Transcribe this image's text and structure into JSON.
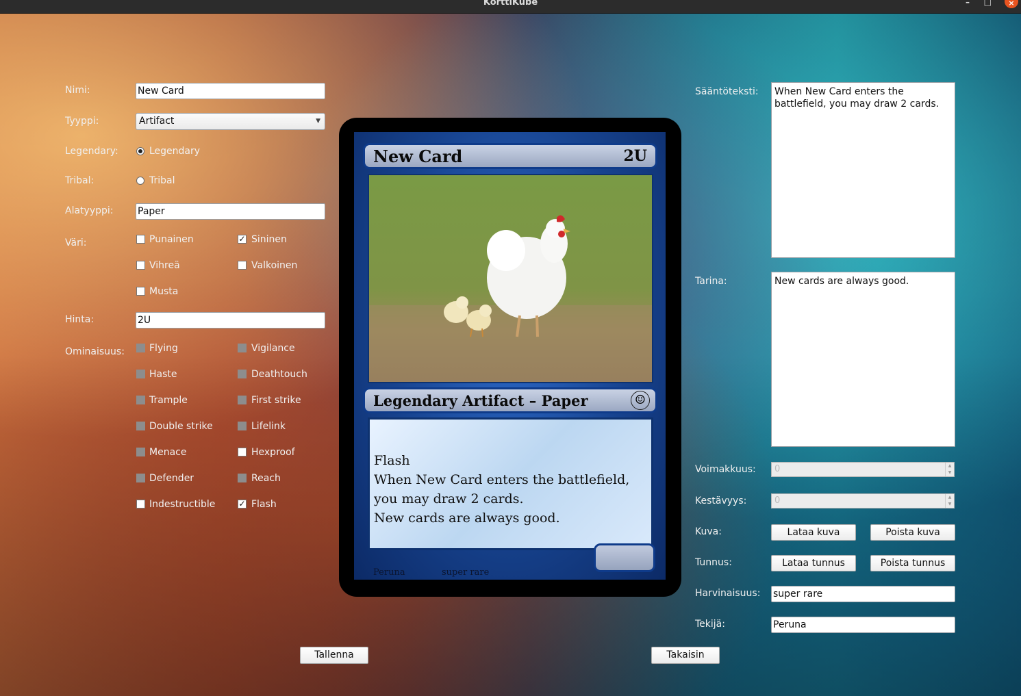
{
  "window": {
    "title": "KorttiKube"
  },
  "form_left": {
    "name_label": "Nimi:",
    "name_value": "New Card",
    "type_label": "Tyyppi:",
    "type_value": "Artifact",
    "legendary_label": "Legendary:",
    "legendary_option": "Legendary",
    "tribal_label": "Tribal:",
    "tribal_option": "Tribal",
    "subtype_label": "Alatyyppi:",
    "subtype_value": "Paper",
    "color_label": "Väri:",
    "colors": [
      {
        "label": "Punainen",
        "checked": false
      },
      {
        "label": "Sininen",
        "checked": true
      },
      {
        "label": "Vihreä",
        "checked": false
      },
      {
        "label": "Valkoinen",
        "checked": false
      },
      {
        "label": "Musta",
        "checked": false
      }
    ],
    "cost_label": "Hinta:",
    "cost_value": "2U",
    "ability_label": "Ominaisuus:",
    "abilities": [
      {
        "label": "Flying",
        "checked": false,
        "enabled": false
      },
      {
        "label": "Vigilance",
        "checked": false,
        "enabled": false
      },
      {
        "label": "Haste",
        "checked": false,
        "enabled": false
      },
      {
        "label": "Deathtouch",
        "checked": false,
        "enabled": false
      },
      {
        "label": "Trample",
        "checked": false,
        "enabled": false
      },
      {
        "label": "First strike",
        "checked": false,
        "enabled": false
      },
      {
        "label": "Double strike",
        "checked": false,
        "enabled": false
      },
      {
        "label": "Lifelink",
        "checked": false,
        "enabled": false
      },
      {
        "label": "Menace",
        "checked": false,
        "enabled": false
      },
      {
        "label": "Hexproof",
        "checked": false,
        "enabled": true
      },
      {
        "label": "Defender",
        "checked": false,
        "enabled": false
      },
      {
        "label": "Reach",
        "checked": false,
        "enabled": false
      },
      {
        "label": "Indestructible",
        "checked": false,
        "enabled": true
      },
      {
        "label": "Flash",
        "checked": true,
        "enabled": true
      }
    ]
  },
  "card": {
    "name": "New Card",
    "cost": "2U",
    "type_line": "Legendary Artifact – Paper",
    "rules_lines": [
      "Flash",
      "When New Card enters the battlefield, you may draw 2 cards.",
      "New cards are always good."
    ],
    "artist": "Peruna",
    "rarity": "super rare",
    "set_symbol_icon": "smiley-icon",
    "art_icon": "hen-with-chicks-image"
  },
  "form_right": {
    "rules_label": "Sääntöteksti:",
    "rules_value": "When New Card enters the battlefield, you may draw 2 cards.",
    "flavor_label": "Tarina:",
    "flavor_value": "New cards are always good.",
    "power_label": "Voimakkuus:",
    "power_value": "0",
    "toughness_label": "Kestävyys:",
    "toughness_value": "0",
    "image_label": "Kuva:",
    "load_image": "Lataa kuva",
    "remove_image": "Poista kuva",
    "symbol_label": "Tunnus:",
    "load_symbol": "Lataa tunnus",
    "remove_symbol": "Poista tunnus",
    "rarity_label": "Harvinaisuus:",
    "rarity_value": "super rare",
    "artist_label": "Tekijä:",
    "artist_value": "Peruna"
  },
  "actions": {
    "save": "Tallenna",
    "back": "Takaisin"
  },
  "colors": {
    "card_blue": "#17438f",
    "title_bar": "#b3bdd3",
    "window_close": "#e95420"
  }
}
